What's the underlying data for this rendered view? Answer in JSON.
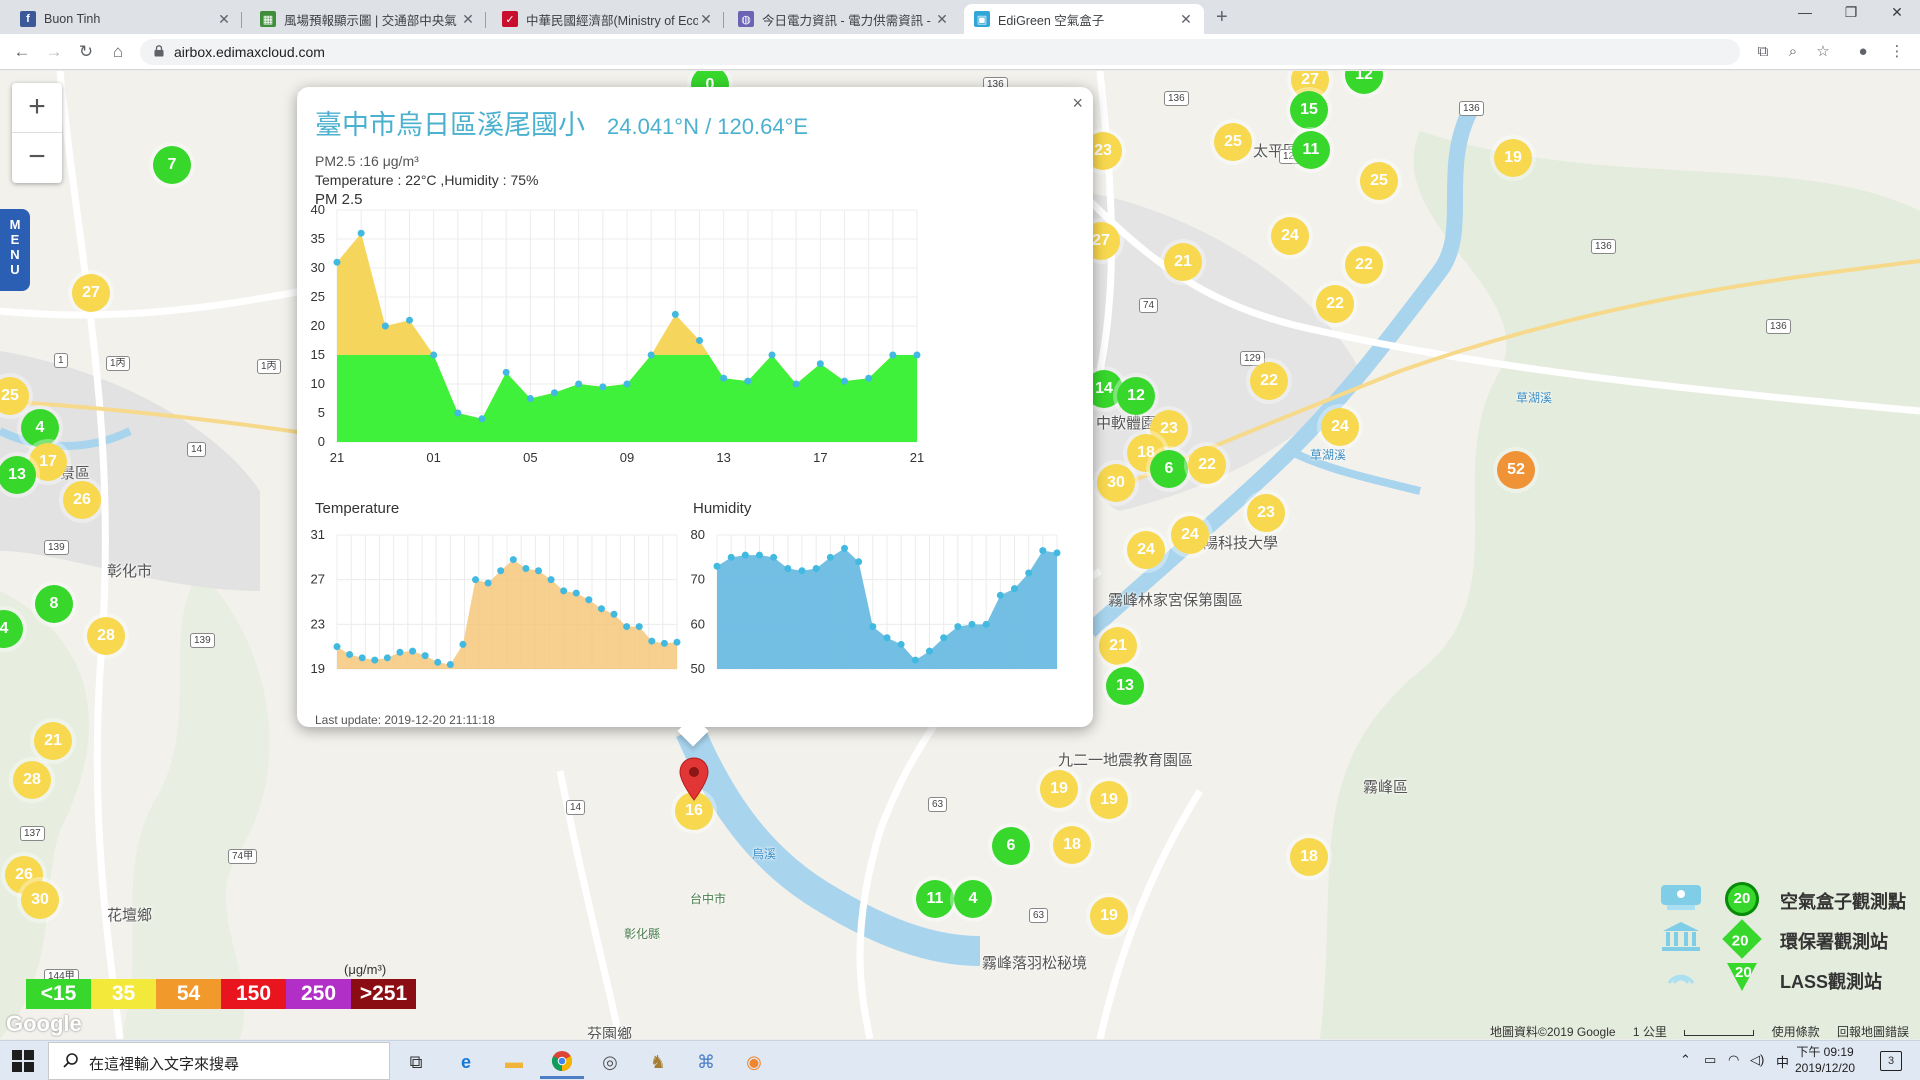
{
  "browser": {
    "tabs": [
      {
        "title": "Buon Tinh",
        "favicon_color": "#3b5998",
        "favicon_glyph": "f"
      },
      {
        "title": "風場預報顯示圖 | 交通部中央氣",
        "favicon_color": "#3e8e3c",
        "favicon_glyph": "▦"
      },
      {
        "title": "中華民國經濟部(Ministry of Eco",
        "favicon_color": "#c8102e",
        "favicon_glyph": "✓"
      },
      {
        "title": "今日電力資訊 - 電力供需資訊 - 臺",
        "favicon_color": "#6c63b5",
        "favicon_glyph": "◍"
      },
      {
        "title": "EdiGreen 空氣盒子",
        "favicon_color": "#33a6d8",
        "favicon_glyph": "▣"
      }
    ],
    "active_tab": 4,
    "url": "airbox.edimaxcloud.com"
  },
  "map": {
    "labels": [
      {
        "text": "彰化市",
        "cls": ""
      },
      {
        "text": "花壇鄉",
        "cls": ""
      },
      {
        "text": "芬園鄉",
        "cls": ""
      },
      {
        "text": "霧峰區",
        "cls": ""
      },
      {
        "text": "九二一地震教育園區",
        "cls": ""
      },
      {
        "text": "霧峰落羽松秘境",
        "cls": ""
      },
      {
        "text": "霧峰林家宮保第園區",
        "cls": ""
      },
      {
        "text": "朝陽科技大學",
        "cls": ""
      },
      {
        "text": "中軟體園區",
        "cls": ""
      },
      {
        "text": "太平區",
        "cls": ""
      },
      {
        "text": "景區",
        "cls": ""
      },
      {
        "text": "草湖溪",
        "cls": "water"
      },
      {
        "text": "草湖溪",
        "cls": "water"
      },
      {
        "text": "烏溪",
        "cls": "water"
      },
      {
        "text": "台中市",
        "cls": "small"
      },
      {
        "text": "彰化縣",
        "cls": "small"
      }
    ],
    "markers": [
      {
        "v": "7",
        "c": "g"
      },
      {
        "v": "0",
        "c": "g"
      },
      {
        "v": "27",
        "c": "y"
      },
      {
        "v": "25",
        "c": "y"
      },
      {
        "v": "4",
        "c": "g"
      },
      {
        "v": "17",
        "c": "y"
      },
      {
        "v": "13",
        "c": "g"
      },
      {
        "v": "26",
        "c": "y"
      },
      {
        "v": "8",
        "c": "g"
      },
      {
        "v": "28",
        "c": "y"
      },
      {
        "v": "21",
        "c": "y"
      },
      {
        "v": "28",
        "c": "y"
      },
      {
        "v": "26",
        "c": "y"
      },
      {
        "v": "30",
        "c": "y"
      },
      {
        "v": "4",
        "c": "g"
      },
      {
        "v": "18",
        "c": "y"
      },
      {
        "v": "6",
        "c": "g"
      },
      {
        "v": "27",
        "c": "y"
      },
      {
        "v": "12",
        "c": "g"
      },
      {
        "v": "15",
        "c": "g"
      },
      {
        "v": "11",
        "c": "g"
      },
      {
        "v": "25",
        "c": "y"
      },
      {
        "v": "23",
        "c": "y"
      },
      {
        "v": "25",
        "c": "y"
      },
      {
        "v": "19",
        "c": "y"
      },
      {
        "v": "27",
        "c": "y"
      },
      {
        "v": "24",
        "c": "y"
      },
      {
        "v": "21",
        "c": "y"
      },
      {
        "v": "22",
        "c": "y"
      },
      {
        "v": "22",
        "c": "y"
      },
      {
        "v": "22",
        "c": "y"
      },
      {
        "v": "24",
        "c": "y"
      },
      {
        "v": "14",
        "c": "g"
      },
      {
        "v": "12",
        "c": "g"
      },
      {
        "v": "23",
        "c": "y"
      },
      {
        "v": "18",
        "c": "y"
      },
      {
        "v": "30",
        "c": "y"
      },
      {
        "v": "6",
        "c": "g"
      },
      {
        "v": "22",
        "c": "y"
      },
      {
        "v": "52",
        "c": "o"
      },
      {
        "v": "23",
        "c": "y"
      },
      {
        "v": "24",
        "c": "y"
      },
      {
        "v": "24",
        "c": "y"
      },
      {
        "v": "21",
        "c": "y"
      },
      {
        "v": "13",
        "c": "g"
      },
      {
        "v": "19",
        "c": "y"
      },
      {
        "v": "19",
        "c": "y"
      },
      {
        "v": "18",
        "c": "y"
      },
      {
        "v": "11",
        "c": "g"
      },
      {
        "v": "4",
        "c": "g"
      },
      {
        "v": "19",
        "c": "y"
      },
      {
        "v": "16",
        "c": "y"
      }
    ],
    "route_shields": [
      "136",
      "136",
      "136",
      "136",
      "136",
      "129",
      "129",
      "139",
      "139",
      "137",
      "14",
      "14",
      "74",
      "74甲",
      "144甲",
      "63",
      "63",
      "1丙",
      "1丙",
      "1"
    ],
    "zoom_in": "+",
    "zoom_out": "−",
    "menu_label": "MENU",
    "aqi_legend": {
      "unit": "(μg/m³)",
      "levels": [
        {
          "label": "<15",
          "color": "#37d72c"
        },
        {
          "label": "35",
          "color": "#f3e93a"
        },
        {
          "label": "54",
          "color": "#f19a2b"
        },
        {
          "label": "150",
          "color": "#e8141e"
        },
        {
          "label": "250",
          "color": "#b22fc7"
        },
        {
          "label": ">251",
          "color": "#8b0d14"
        }
      ]
    },
    "station_legend": [
      {
        "value": "20",
        "label": "空氣盒子觀測點",
        "shape": "circle"
      },
      {
        "value": "20",
        "label": "環保署觀測站",
        "shape": "diamond"
      },
      {
        "value": "20",
        "label": "LASS觀測站",
        "shape": "triangle"
      }
    ],
    "google_logo": "Google",
    "attribution": [
      "地圖資料©2019 Google",
      "1 公里",
      "使用條款",
      "回報地圖錯誤"
    ]
  },
  "popup": {
    "title": "臺中市烏日區溪尾國小",
    "coords": "24.041°N / 120.64°E",
    "pm_line": "PM2.5 :16 μg/m³",
    "temp_line": "Temperature : 22°C ,Humidity : 75%",
    "section_pm": "PM 2.5",
    "section_temp": "Temperature",
    "section_hum": "Humidity",
    "last_update": "Last update: 2019-12-20 21:11:18",
    "close": "×"
  },
  "chart_data": [
    {
      "type": "area",
      "title": "PM 2.5",
      "x_tick_labels": [
        "21",
        "01",
        "05",
        "09",
        "13",
        "17",
        "21"
      ],
      "ylim": [
        0,
        40
      ],
      "y_ticks": [
        0,
        5,
        10,
        15,
        20,
        25,
        30,
        35,
        40
      ],
      "series": [
        {
          "values": [
            31,
            36,
            20,
            21,
            15,
            5,
            4,
            12,
            7.5,
            8.5,
            10,
            9.5,
            10,
            15,
            22,
            17.5,
            11,
            10.5,
            15,
            10,
            13.5,
            10.5,
            11,
            15,
            15
          ]
        }
      ],
      "threshold": 15,
      "colors": {
        "below": "#3ff13a",
        "above": "#f6d55c"
      },
      "grid": true
    },
    {
      "type": "area",
      "title": "Temperature",
      "ylim": [
        19,
        31
      ],
      "y_ticks": [
        19,
        23,
        27,
        31
      ],
      "series": [
        {
          "values": [
            21,
            20.3,
            20,
            19.8,
            20,
            20.5,
            20.6,
            20.2,
            19.6,
            19.4,
            21.2,
            27,
            26.7,
            27.8,
            28.8,
            28,
            27.8,
            27,
            26,
            25.8,
            25.2,
            24.4,
            23.9,
            22.8,
            22.8,
            21.5,
            21.3,
            21.4
          ]
        }
      ],
      "color": "#f6c77a",
      "grid": true
    },
    {
      "type": "area",
      "title": "Humidity",
      "ylim": [
        50,
        80
      ],
      "y_ticks": [
        50,
        60,
        70,
        80
      ],
      "series": [
        {
          "values": [
            73,
            75,
            75.5,
            75.5,
            75,
            72.5,
            72,
            72.5,
            75,
            77,
            74,
            59.5,
            57,
            55.5,
            52,
            54,
            57,
            59.5,
            60,
            60,
            66.5,
            68,
            71.5,
            76.5,
            76
          ]
        }
      ],
      "color": "#6bbce3",
      "grid": true
    }
  ],
  "taskbar": {
    "search_placeholder": "在這裡輸入文字來搜尋",
    "apps": [
      "task-view",
      "edge",
      "file-explorer",
      "chrome",
      "app-compass",
      "app-owl",
      "app-network",
      "app-blender"
    ],
    "ime": "中",
    "clock_time": "下午 09:19",
    "clock_date": "2019/12/20",
    "notification_count": "3"
  }
}
